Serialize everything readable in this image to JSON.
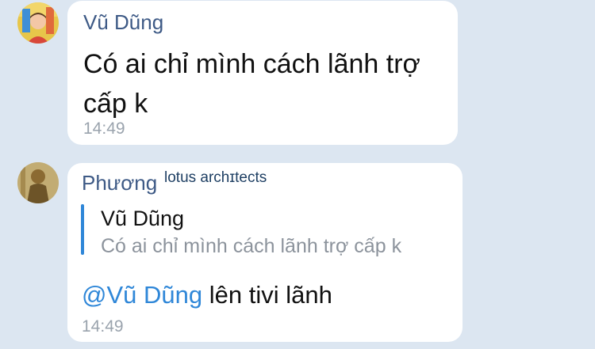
{
  "messages": [
    {
      "sender": "Vũ Dũng",
      "text": "Có ai chỉ mình cách lãnh trợ cấp k",
      "time": "14:49",
      "avatar": "child-photo-avatar"
    },
    {
      "sender": "Phương",
      "sender_tag": "lotus archɪtects",
      "quote": {
        "author": "Vũ Dũng",
        "text": "Có ai chỉ mình cách lãnh trợ cấp k"
      },
      "mention": "@Vũ Dũng",
      "reply": " lên tivi lãnh",
      "time": "14:49",
      "avatar": "statue-photo-avatar"
    }
  ],
  "colors": {
    "background": "#dce6f1",
    "bubble": "#ffffff",
    "sender_name": "#3e5a86",
    "mention": "#2f87d8",
    "quote_bar": "#2f87d8",
    "timestamp": "#9aa3ad"
  }
}
